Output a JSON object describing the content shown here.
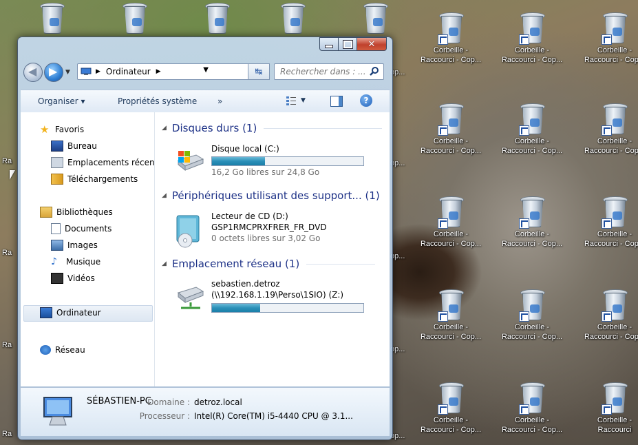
{
  "desktop": {
    "icon_title": "Corbeille -",
    "icon_subtitle": "Raccourci - Cop...",
    "icon_subtitle_last": "Raccourci",
    "partial_left": "Ra",
    "partial_left2": "op..."
  },
  "window": {
    "address": {
      "breadcrumb": "Ordinateur"
    },
    "search": {
      "placeholder": "Rechercher dans : ..."
    },
    "toolbar": {
      "organize": "Organiser",
      "system_properties": "Propriétés système",
      "more": "»"
    },
    "nav": {
      "favorites": "Favoris",
      "desktop": "Bureau",
      "recent": "Emplacements récents",
      "downloads": "Téléchargements",
      "libraries": "Bibliothèques",
      "documents": "Documents",
      "images": "Images",
      "music": "Musique",
      "videos": "Vidéos",
      "computer": "Ordinateur",
      "network": "Réseau"
    },
    "groups": {
      "hard_disks": "Disques durs (1)",
      "removable": "Périphériques utilisant des support... (1)",
      "network": "Emplacement réseau (1)"
    },
    "drives": {
      "local": {
        "name": "Disque local (C:)",
        "free": "16,2 Go libres sur 24,8 Go",
        "used_fraction": 0.35
      },
      "cd": {
        "name": "Lecteur de CD (D:)",
        "label": "GSP1RMCPRXFRER_FR_DVD",
        "free": "0 octets libres sur 3,02 Go"
      },
      "net": {
        "name": "sebastien.detroz",
        "path": "(\\\\192.168.1.19\\Perso\\1SIO) (Z:)",
        "used_fraction": 0.32
      }
    },
    "details": {
      "computer_name": "SÉBASTIEN-PC",
      "domain_label": "Domaine :",
      "domain_value": "detroz.local",
      "cpu_label": "Processeur :",
      "cpu_value": "Intel(R) Core(TM) i5-4440 CPU @ 3.1..."
    }
  },
  "colors": {
    "group_header": "#1e3287",
    "bar_fill": "#2b8fb8"
  },
  "icons": [
    "recycle-bin-icon",
    "shortcut-arrow-icon",
    "back-arrow-icon",
    "forward-arrow-icon",
    "computer-icon",
    "refresh-icon",
    "search-icon",
    "views-icon",
    "preview-pane-icon",
    "help-icon",
    "star-icon",
    "desktop-icon",
    "recent-places-icon",
    "downloads-icon",
    "libraries-icon",
    "documents-icon",
    "images-icon",
    "music-icon",
    "videos-icon",
    "network-icon",
    "hard-disk-icon",
    "cd-drive-icon",
    "network-drive-icon"
  ]
}
